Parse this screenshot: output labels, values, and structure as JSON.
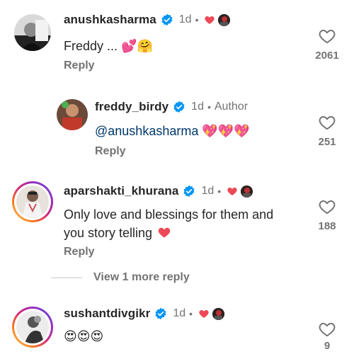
{
  "comments": [
    {
      "username": "anushkasharma",
      "time": "1d",
      "text": "Freddy ...",
      "emojis": [
        "💕",
        "🤗"
      ],
      "reply_label": "Reply",
      "likes": "2061"
    },
    {
      "username": "freddy_birdy",
      "time": "1d",
      "tag": "Author",
      "mention": "@anushkasharma",
      "emojis": [
        "💖",
        "💖",
        "💖"
      ],
      "reply_label": "Reply",
      "likes": "251"
    },
    {
      "username": "aparshakti_khurana",
      "time": "1d",
      "text_line1": "Only love and blessings for them and",
      "text_line2": "you story telling",
      "reply_label": "Reply",
      "likes": "188"
    },
    {
      "username": "sushantdivgikr",
      "time": "1d",
      "emojis": [
        "😍",
        "😍",
        "😍"
      ],
      "likes": "9"
    }
  ],
  "view_more": "View 1 more reply",
  "colors": {
    "verified_blue": "#0095f6",
    "heart_red": "#ed4956",
    "muted": "#737373",
    "mention": "#00376b"
  },
  "separator": "•"
}
